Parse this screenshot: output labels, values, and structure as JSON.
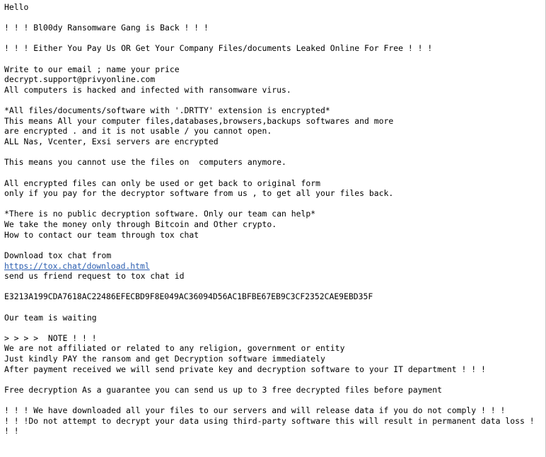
{
  "document": {
    "type": "plain-text-ransom-note",
    "background_color": "#ffffff",
    "text_color": "#000000",
    "link_color": "#2a5db0",
    "border_color": "#c8c8c8"
  },
  "note": {
    "greeting": "Hello",
    "headline_gang": "! ! ! Bl00dy Ransomware Gang is Back ! ! !",
    "headline_threat": "! ! ! Either You Pay Us OR Get Your Company Files/documents Leaked Online For Free ! ! !",
    "contact_intro": "Write to our email ; name your price",
    "contact_email": "decrypt.support@privyonline.com",
    "infection_statement": "All computers is hacked and infected with ransomware virus.",
    "encryption_extension_line": "*All files/documents/software with '.DRTTY' extension is encrypted*",
    "encryption_scope_line1": "This means All your computer files,databases,browsers,backups softwares and more",
    "encryption_scope_line2": "are encrypted . and it is not usable / you cannot open.",
    "encryption_servers_line": "ALL Nas, Vcenter, Exsi servers are encrypted",
    "unusable_statement": "This means you cannot use the files on  computers anymore.",
    "recovery_line1": "All encrypted files can only be used or get back to original form",
    "recovery_line2": "only if you pay for the decryptor software from us , to get all your files back.",
    "no_public_decryptor": "*There is no public decryption software. Only our team can help*",
    "payment_method": "We take the money only through Bitcoin and Other crypto.",
    "contact_method": "How to contact our team through tox chat",
    "download_intro": "Download tox chat from",
    "tox_download_url": "https://tox.chat/download.html",
    "friend_request_line": "send us friend request to tox chat id",
    "tox_chat_id": "E3213A199CDA7618AC22486EFECBD9F8E049AC36094D56AC1BFBE67EB9C3CF2352CAE9EBD35F",
    "waiting_line": "Our team is waiting",
    "note_header": "> > > >  NOTE ! ! !",
    "note_line1": "We are not affiliated or related to any religion, government or entity",
    "note_line2": "Just kindly PAY the ransom and get Decryption software immediately",
    "note_line3": "After payment received we will send private key and decryption software to your IT department ! ! !",
    "free_decryption": "Free decryption As a guarantee you can send us up to 3 free decrypted files before payment",
    "exfiltration_warning": "! ! ! We have downloaded all your files to our servers and will release data if you do not comply ! ! !",
    "third_party_warning": "! ! !Do not attempt to decrypt your data using third-party software this will result in permanent data loss ! ! !"
  }
}
